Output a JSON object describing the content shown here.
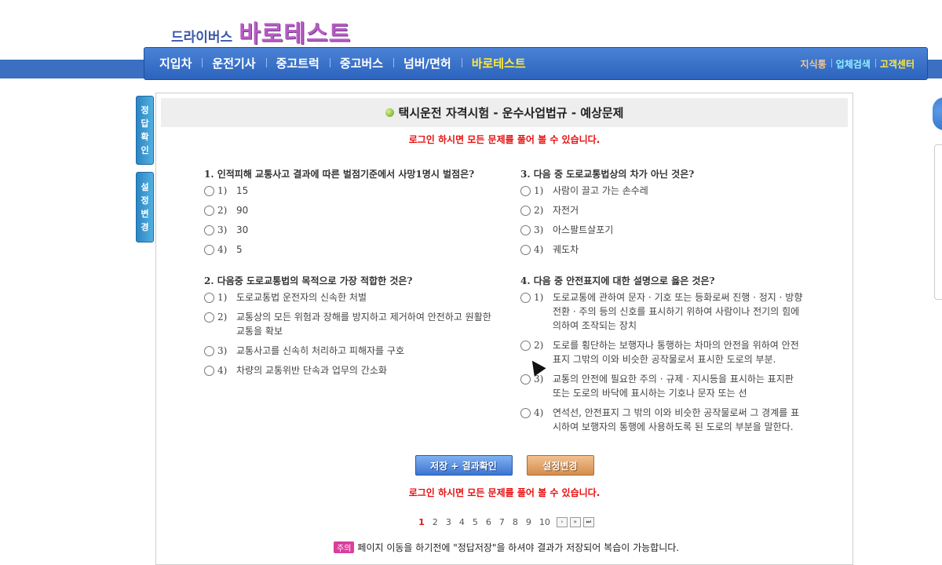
{
  "logo": {
    "sub": "드라이버스",
    "main": "바로테스트"
  },
  "nav": {
    "items": [
      "지입차",
      "운전기사",
      "중고트럭",
      "중고버스",
      "넘버/면허",
      "바로테스트"
    ],
    "right": [
      "지식통",
      "업체검색",
      "고객센터"
    ]
  },
  "side_buttons": [
    {
      "label": [
        "정",
        "답",
        "확",
        "인"
      ]
    },
    {
      "label": [
        "설",
        "정",
        "변",
        "경"
      ]
    }
  ],
  "header": {
    "title": "택시운전 자격시험 - 운수사업법규 - 예상문제"
  },
  "notice_text": "로그인 하시면 모든 문제를 풀어 볼 수 있습니다.",
  "questions": [
    {
      "title": "1. 인적피해 교통사고 결과에 따른 벌점기준에서 사망1명시 벌점은?",
      "options": [
        {
          "num": "1)",
          "text": "15"
        },
        {
          "num": "2)",
          "text": "90"
        },
        {
          "num": "3)",
          "text": "30"
        },
        {
          "num": "4)",
          "text": "5"
        }
      ]
    },
    {
      "title": "2. 다음중 도로교통법의 목적으로 가장 적합한 것은?",
      "options": [
        {
          "num": "1)",
          "text": "도로교통법 운전자의 신속한 처벌"
        },
        {
          "num": "2)",
          "text": "교통상의 모든 위험과 장해를 방지하고 제거하여 안전하고 원활한 교통을 확보"
        },
        {
          "num": "3)",
          "text": "교통사고를 신속히 처리하고 피해자를 구호"
        },
        {
          "num": "4)",
          "text": "차량의 교통위반 단속과 업무의 간소화"
        }
      ]
    },
    {
      "title": "3. 다음 중 도로교통법상의 차가 아닌 것은?",
      "options": [
        {
          "num": "1)",
          "text": "사람이 끌고 가는 손수레"
        },
        {
          "num": "2)",
          "text": "자전거"
        },
        {
          "num": "3)",
          "text": "아스팔트살포기"
        },
        {
          "num": "4)",
          "text": "궤도차"
        }
      ]
    },
    {
      "title": "4. 다음 중 안전표지에 대한 설명으로 옳은 것은?",
      "options": [
        {
          "num": "1)",
          "text": "도로교통에 관하여 문자 · 기호 또는 등화로써 진행 · 정지 · 방향전환 · 주의 등의 신호를 표시하기 위하여 사람이나 전기의 힘에 의하여 조작되는 장치"
        },
        {
          "num": "2)",
          "text": "도로를 횡단하는 보행자나 통행하는 차마의 안전을 위하여 안전표지 그밖의 이와 비슷한 공작물로서 표시한 도로의 부분."
        },
        {
          "num": "3)",
          "text": "교통의 안전에 필요한 주의 · 규제 · 지시등을 표시하는 표지판 또는 도로의 바닥에 표시하는 기호나 문자 또는 선"
        },
        {
          "num": "4)",
          "text": "연석선, 안전표지 그 밖의 이와 비슷한 공작물로써 그 경계를 표시하여 보행자의 통행에 사용하도록 된 도로의 부분을 말한다."
        }
      ]
    }
  ],
  "buttons": {
    "save": "저장 + 결과확인",
    "setting": "설정변경"
  },
  "pagination": {
    "pages": [
      "1",
      "2",
      "3",
      "4",
      "5",
      "6",
      "7",
      "8",
      "9",
      "10"
    ],
    "current": "1",
    "arrows": [
      "›",
      "»",
      "⏭"
    ]
  },
  "tip": {
    "badge": "주의",
    "text": "페이지 이동을 하기전에 \"정답저장\"을 하셔야 결과가 저장되어 복습이 가능합니다."
  }
}
